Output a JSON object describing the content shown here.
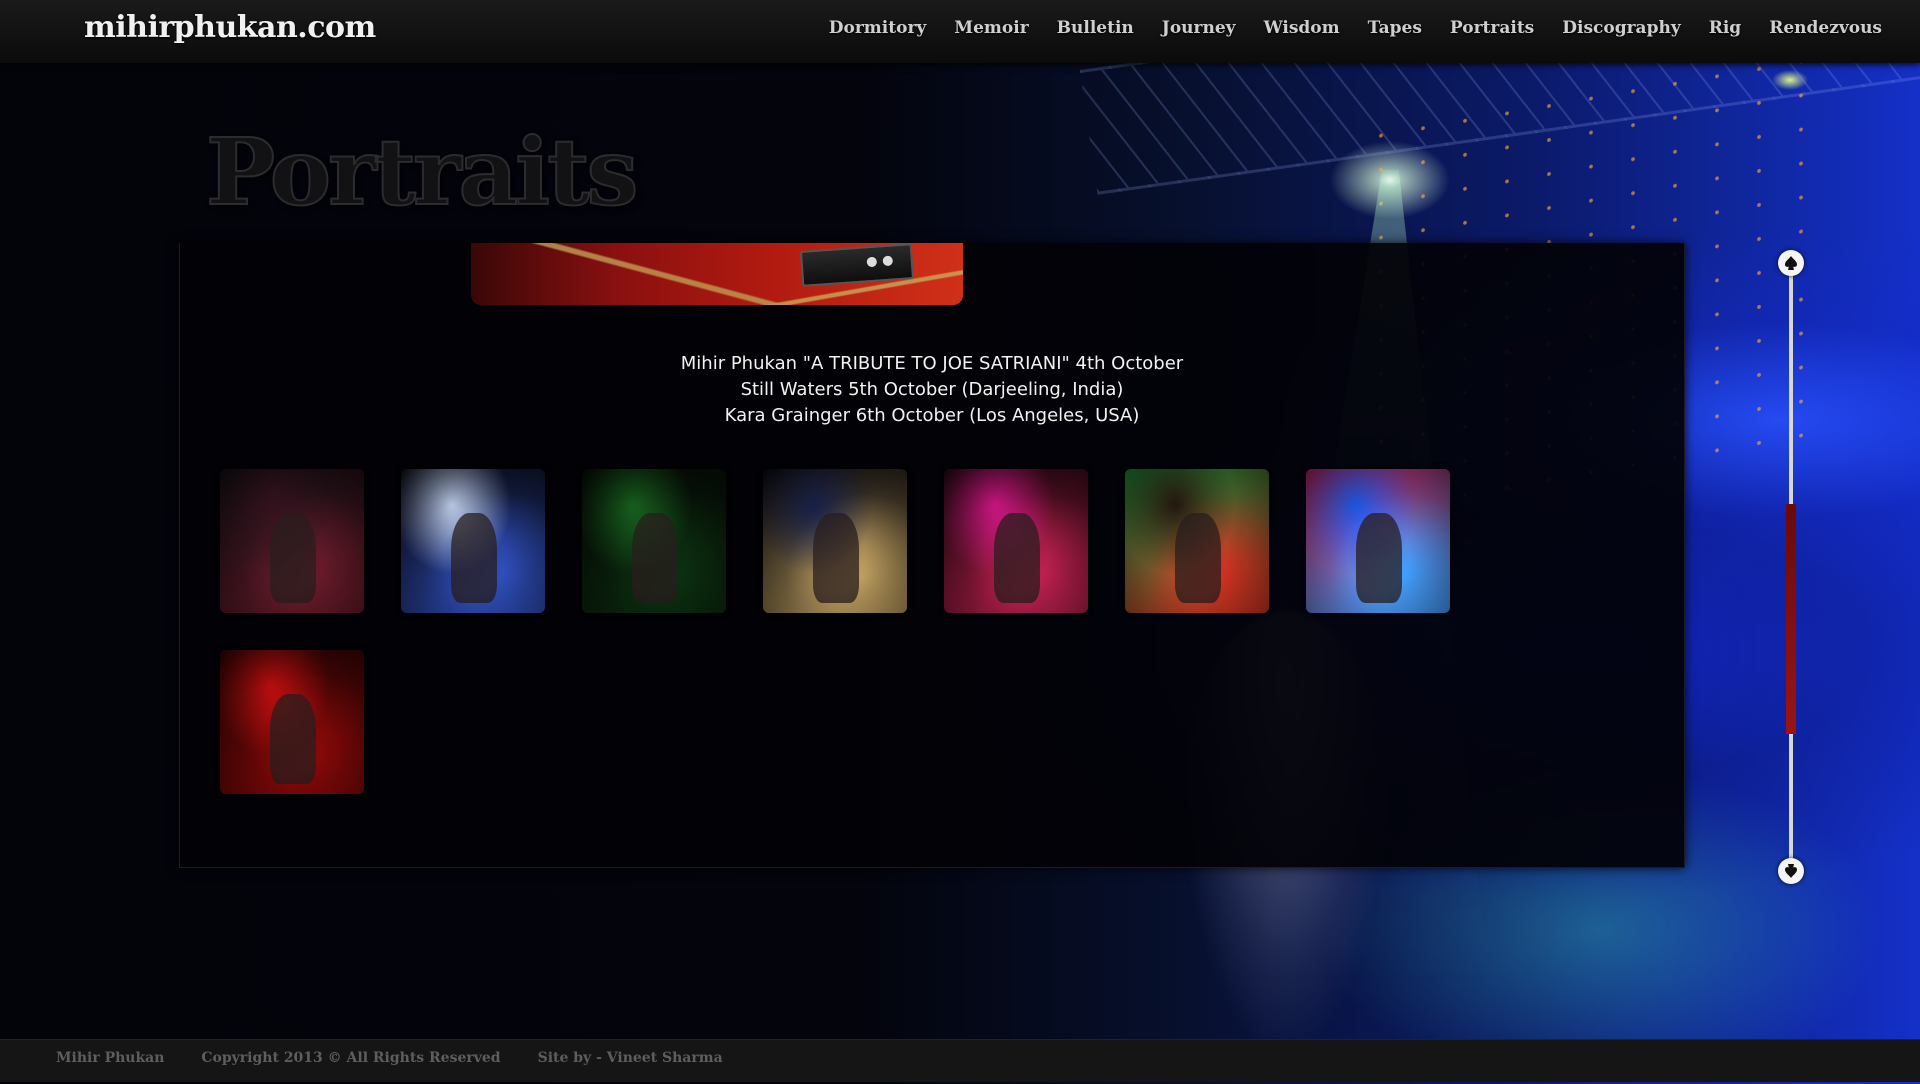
{
  "header": {
    "logo": "mihirphukan.com",
    "nav": [
      "Dormitory",
      "Memoir",
      "Bulletin",
      "Journey",
      "Wisdom",
      "Tapes",
      "Portraits",
      "Discography",
      "Rig",
      "Rendezvous"
    ]
  },
  "page": {
    "heading": "Portraits"
  },
  "events": [
    "Mihir Phukan \"A TRIBUTE TO JOE SATRIANI\" 4th October",
    "Still Waters 5th October (Darjeeling, India)",
    "Kara Grainger 6th October (Los Angeles, USA)"
  ],
  "gallery": {
    "thumbnails": [
      {
        "colors": [
          "#3a1420",
          "#6a1a2a",
          "#101014"
        ]
      },
      {
        "colors": [
          "#cfe0ff",
          "#3050c0",
          "#0a0a14"
        ]
      },
      {
        "colors": [
          "#1a6a20",
          "#0c3010",
          "#050805"
        ]
      },
      {
        "colors": [
          "#1a2450",
          "#c0a060",
          "#080810"
        ]
      },
      {
        "colors": [
          "#e01890",
          "#c02050",
          "#200810"
        ]
      },
      {
        "colors": [
          "#2a1a10",
          "#d03020",
          "#20a040"
        ]
      },
      {
        "colors": [
          "#2060ff",
          "#40a0ff",
          "#d02060"
        ]
      },
      {
        "colors": [
          "#d01010",
          "#8a0808",
          "#300404"
        ]
      }
    ]
  },
  "scrollbar": {
    "position_fraction": 0.58
  },
  "footer": {
    "name": "Mihir Phukan",
    "copyright": "Copyright 2013 © All Rights Reserved",
    "credit": "Site by - Vineet Sharma"
  }
}
